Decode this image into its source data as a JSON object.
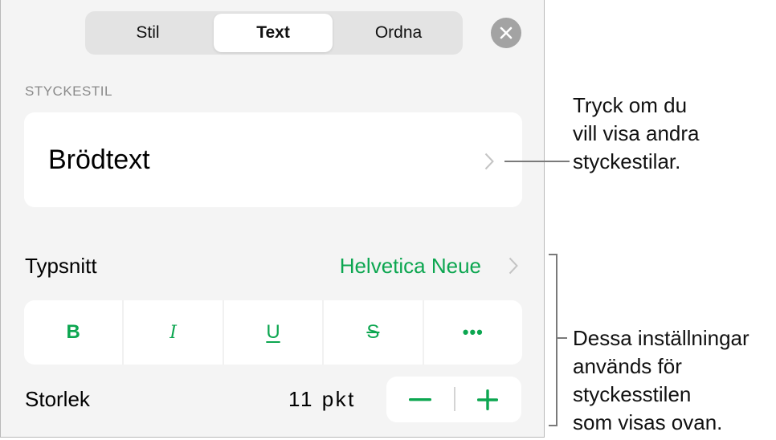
{
  "tabs": [
    {
      "label": "Stil",
      "selected": false
    },
    {
      "label": "Text",
      "selected": true
    },
    {
      "label": "Ordna",
      "selected": false
    }
  ],
  "close_icon": "close-icon",
  "paragraph_style": {
    "section_label": "STYCKESTIL",
    "current": "Brödtext",
    "chevron_icon": "chevron-right-icon"
  },
  "font": {
    "label": "Typsnitt",
    "value": "Helvetica Neue"
  },
  "format_buttons": [
    {
      "id": "bold",
      "label": "B"
    },
    {
      "id": "italic",
      "label": "I"
    },
    {
      "id": "underline",
      "label": "U"
    },
    {
      "id": "strikethrough",
      "label": "S"
    },
    {
      "id": "more",
      "label": "•••"
    }
  ],
  "size": {
    "label": "Storlek",
    "value": "11 pkt",
    "decrement_icon": "minus-icon",
    "increment_icon": "plus-icon"
  },
  "colors": {
    "accent": "#0ca650",
    "panel_bg": "#f4f4f4",
    "section_label": "#8a8a8a",
    "close_bg": "#a3a3a3"
  },
  "callouts": {
    "style_callout": [
      "Tryck om du",
      "vill visa andra",
      "styckestilar."
    ],
    "settings_callout": [
      "Dessa inställningar",
      "används för",
      "styckesstilen",
      "som visas ovan."
    ]
  }
}
